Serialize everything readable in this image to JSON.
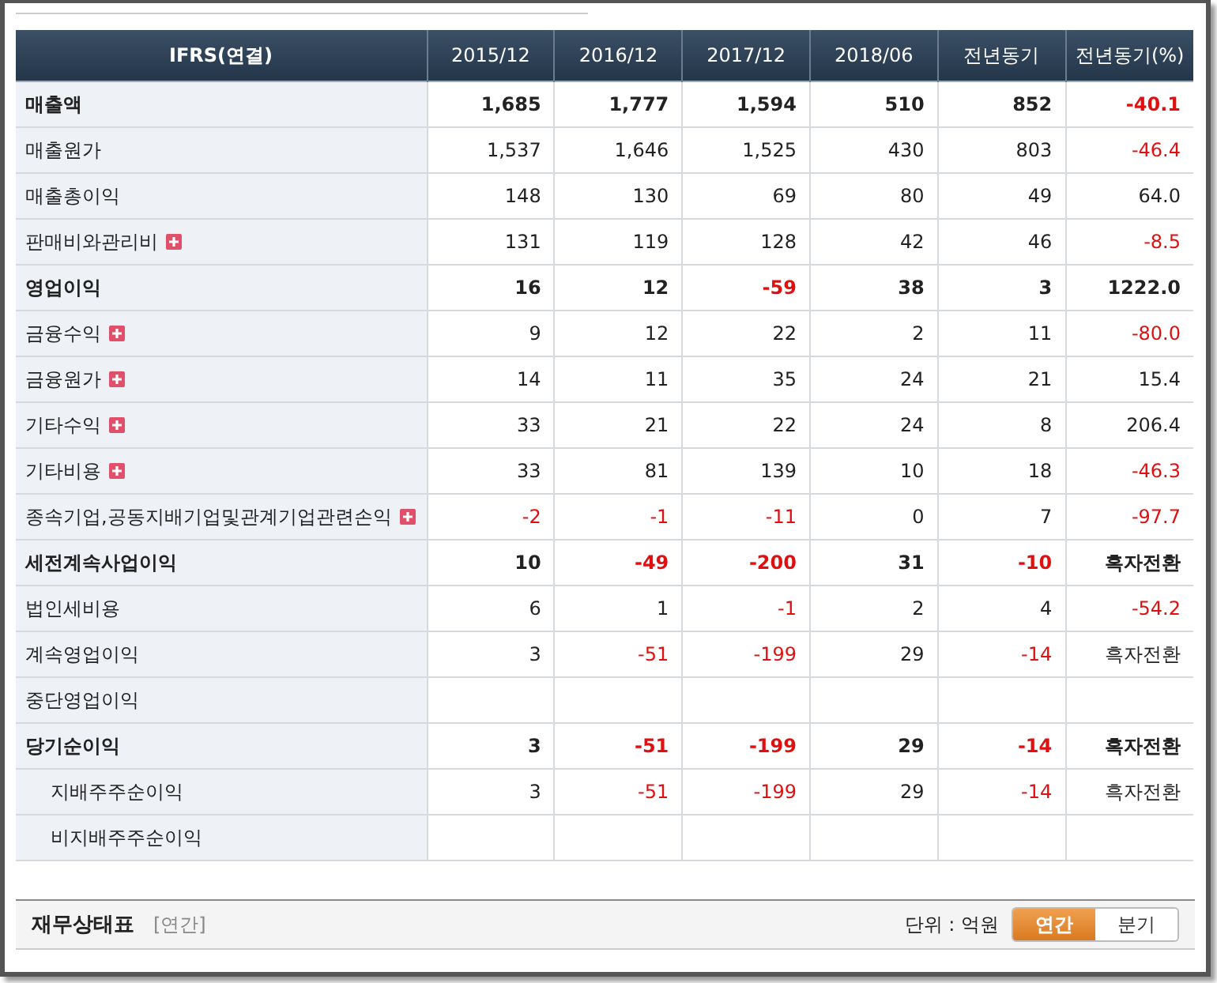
{
  "table": {
    "columns": [
      "IFRS(연결)",
      "2015/12",
      "2016/12",
      "2017/12",
      "2018/06",
      "전년동기",
      "전년동기(%)"
    ],
    "rows": [
      {
        "label": "매출액",
        "bold": true,
        "expandable": false,
        "values": [
          "1,685",
          "1,777",
          "1,594",
          "510",
          "852",
          "-40.1"
        ]
      },
      {
        "label": "매출원가",
        "bold": false,
        "expandable": false,
        "values": [
          "1,537",
          "1,646",
          "1,525",
          "430",
          "803",
          "-46.4"
        ]
      },
      {
        "label": "매출총이익",
        "bold": false,
        "expandable": false,
        "values": [
          "148",
          "130",
          "69",
          "80",
          "49",
          "64.0"
        ]
      },
      {
        "label": "판매비와관리비",
        "bold": false,
        "expandable": true,
        "values": [
          "131",
          "119",
          "128",
          "42",
          "46",
          "-8.5"
        ]
      },
      {
        "label": "영업이익",
        "bold": true,
        "expandable": false,
        "values": [
          "16",
          "12",
          "-59",
          "38",
          "3",
          "1222.0"
        ]
      },
      {
        "label": "금융수익",
        "bold": false,
        "expandable": true,
        "values": [
          "9",
          "12",
          "22",
          "2",
          "11",
          "-80.0"
        ]
      },
      {
        "label": "금융원가",
        "bold": false,
        "expandable": true,
        "values": [
          "14",
          "11",
          "35",
          "24",
          "21",
          "15.4"
        ]
      },
      {
        "label": "기타수익",
        "bold": false,
        "expandable": true,
        "values": [
          "33",
          "21",
          "22",
          "24",
          "8",
          "206.4"
        ]
      },
      {
        "label": "기타비용",
        "bold": false,
        "expandable": true,
        "values": [
          "33",
          "81",
          "139",
          "10",
          "18",
          "-46.3"
        ]
      },
      {
        "label": "종속기업,공동지배기업및관계기업관련손익",
        "bold": false,
        "expandable": true,
        "values": [
          "-2",
          "-1",
          "-11",
          "0",
          "7",
          "-97.7"
        ]
      },
      {
        "label": "세전계속사업이익",
        "bold": true,
        "expandable": false,
        "values": [
          "10",
          "-49",
          "-200",
          "31",
          "-10",
          "흑자전환"
        ]
      },
      {
        "label": "법인세비용",
        "bold": false,
        "expandable": false,
        "values": [
          "6",
          "1",
          "-1",
          "2",
          "4",
          "-54.2"
        ]
      },
      {
        "label": "계속영업이익",
        "bold": false,
        "expandable": false,
        "values": [
          "3",
          "-51",
          "-199",
          "29",
          "-14",
          "흑자전환"
        ]
      },
      {
        "label": "중단영업이익",
        "bold": false,
        "expandable": false
      },
      {
        "label": "당기순이익",
        "bold": true,
        "expandable": false,
        "values": [
          "3",
          "-51",
          "-199",
          "29",
          "-14",
          "흑자전환"
        ],
        "children": [
          {
            "label": "지배주주순이익",
            "bold": false,
            "expandable": false,
            "values": [
              "3",
              "-51",
              "-199",
              "29",
              "-14",
              "흑자전환"
            ]
          },
          {
            "label": "비지배주주순이익",
            "bold": false,
            "expandable": false
          }
        ]
      }
    ]
  },
  "footer": {
    "title": "재무상태표",
    "period": "[연간]",
    "unit": "단위 : 억원",
    "toggle": [
      {
        "label": "연간",
        "selected": true
      },
      {
        "label": "분기",
        "selected": false
      }
    ]
  }
}
